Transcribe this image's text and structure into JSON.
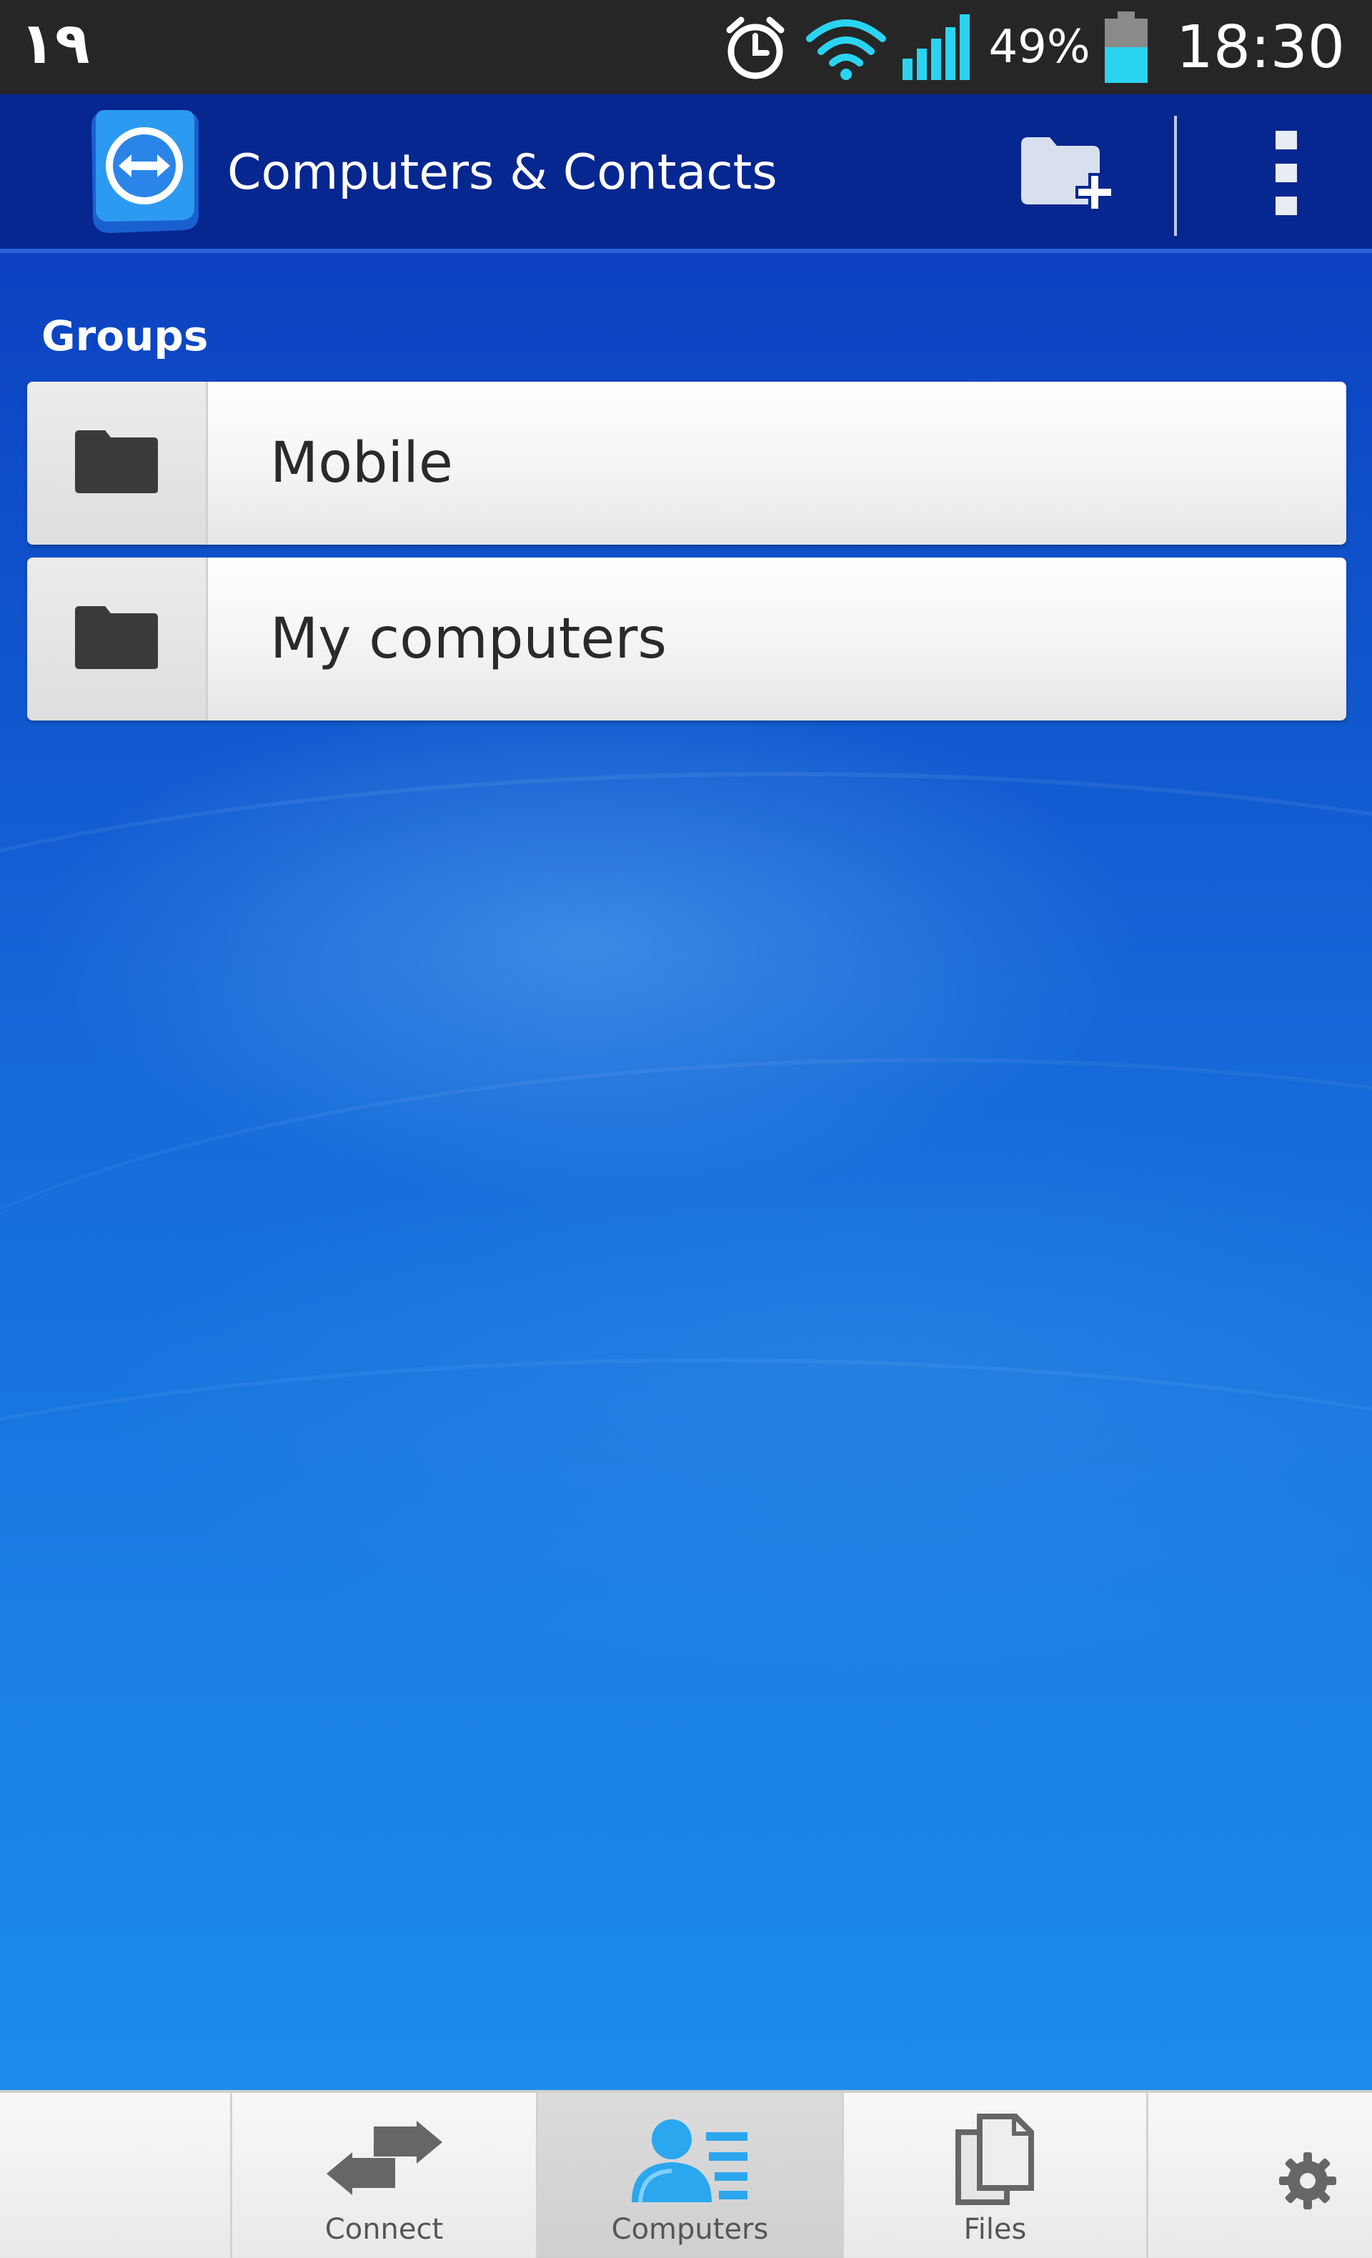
{
  "status_bar": {
    "left_text": "١٩",
    "battery_percent": "49%",
    "time": "18:30",
    "icons": [
      "alarm-icon",
      "wifi-icon",
      "signal-icon",
      "battery-icon"
    ]
  },
  "action_bar": {
    "title": "Computers & Contacts",
    "actions": [
      "add-group-icon",
      "overflow-menu-icon"
    ]
  },
  "groups": {
    "header": "Groups",
    "items": [
      {
        "label": "Mobile",
        "icon": "folder-icon"
      },
      {
        "label": "My computers",
        "icon": "folder-icon"
      }
    ]
  },
  "bottom_nav": {
    "items": [
      {
        "label": "Connect",
        "icon": "connect-arrows-icon",
        "selected": false
      },
      {
        "label": "Computers",
        "icon": "contacts-icon",
        "selected": true
      },
      {
        "label": "Files",
        "icon": "files-icon",
        "selected": false
      },
      {
        "label": "",
        "icon": "gear-icon",
        "selected": false
      }
    ]
  },
  "colors": {
    "status_bar_bg": "#262626",
    "action_bar_bg": "#062690",
    "background_top": "#0b35b8",
    "background_bottom": "#1d8cec",
    "accent_cyan": "#2ad4f0",
    "selected_tab_bg": "#d6d6d6"
  }
}
